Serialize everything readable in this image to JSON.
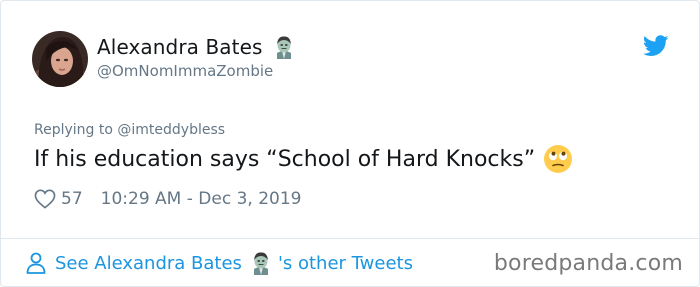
{
  "user": {
    "name": "Alexandra Bates",
    "handle": "@OmNomImmaZombie"
  },
  "tweet": {
    "replying_to": "Replying to @imteddybless",
    "text": "If his education says “School of Hard Knocks”",
    "likes": "57",
    "timestamp": "10:29 AM - Dec 3, 2019"
  },
  "footer": {
    "see_prefix": "See Alexandra Bates",
    "see_suffix": "'s other Tweets",
    "watermark": "boredpanda.com"
  },
  "icons": {
    "brand": "twitter-bird-icon",
    "name_emoji": "zombie-emoji-icon",
    "text_emoji": "eye-roll-emoji-icon",
    "like": "heart-icon",
    "profile": "person-icon"
  },
  "colors": {
    "link": "#1b95e0",
    "muted": "#657786",
    "text": "#14171a",
    "twitter_blue": "#1da1f2"
  }
}
